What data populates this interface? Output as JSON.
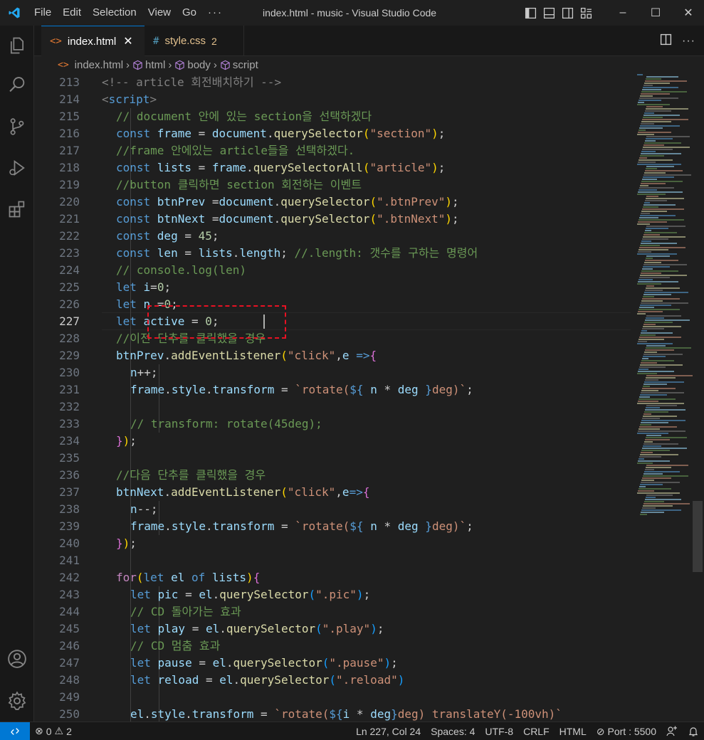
{
  "app": {
    "window_title": "index.html - music - Visual Studio Code",
    "accent": "#0078d4"
  },
  "menu": [
    "File",
    "Edit",
    "Selection",
    "View",
    "Go",
    "···"
  ],
  "window_controls": {
    "minimize": "–",
    "maximize": "☐",
    "close": "✕"
  },
  "tabs": [
    {
      "icon": "<>",
      "label": "index.html",
      "close": "✕"
    },
    {
      "icon": "#",
      "label": "style.css",
      "badge": "2"
    }
  ],
  "tab_actions": {
    "more": "···"
  },
  "breadcrumb": [
    "index.html",
    "html",
    "body",
    "script"
  ],
  "editor": {
    "current_line": 227,
    "lines": [
      {
        "n": "213",
        "tokens": [
          [
            "t",
            "<!-- article 회전배치하기 -->"
          ]
        ]
      },
      {
        "n": "214",
        "tokens": [
          [
            "t",
            "<"
          ],
          [
            "k",
            "script"
          ],
          [
            "t",
            ">"
          ]
        ]
      },
      {
        "n": "215",
        "tokens": [
          [
            "c",
            "// document 안에 있는 section을 선택하겠다"
          ]
        ]
      },
      {
        "n": "216",
        "tokens": [
          [
            "k",
            "const "
          ],
          [
            "v",
            "frame"
          ],
          [
            "d",
            " = "
          ],
          [
            "v",
            "document"
          ],
          [
            "d",
            "."
          ],
          [
            "f",
            "querySelector"
          ],
          [
            "p",
            "("
          ],
          [
            "s",
            "\"section\""
          ],
          [
            "p",
            ")"
          ],
          [
            "d",
            ";"
          ]
        ]
      },
      {
        "n": "217",
        "tokens": [
          [
            "c",
            "//frame 안에있는 article들을 선택하겠다."
          ]
        ]
      },
      {
        "n": "218",
        "tokens": [
          [
            "k",
            "const "
          ],
          [
            "v",
            "lists"
          ],
          [
            "d",
            " = "
          ],
          [
            "v",
            "frame"
          ],
          [
            "d",
            "."
          ],
          [
            "f",
            "querySelectorAll"
          ],
          [
            "p",
            "("
          ],
          [
            "s",
            "\"article\""
          ],
          [
            "p",
            ")"
          ],
          [
            "d",
            ";"
          ]
        ]
      },
      {
        "n": "219",
        "tokens": [
          [
            "c",
            "//button 클릭하면 section 회전하는 이벤트"
          ]
        ]
      },
      {
        "n": "220",
        "tokens": [
          [
            "k",
            "const "
          ],
          [
            "v",
            "btnPrev"
          ],
          [
            "d",
            " ="
          ],
          [
            "v",
            "document"
          ],
          [
            "d",
            "."
          ],
          [
            "f",
            "querySelector"
          ],
          [
            "p",
            "("
          ],
          [
            "s",
            "\".btnPrev\""
          ],
          [
            "p",
            ")"
          ],
          [
            "d",
            ";"
          ]
        ]
      },
      {
        "n": "221",
        "tokens": [
          [
            "k",
            "const "
          ],
          [
            "v",
            "btnNext"
          ],
          [
            "d",
            " ="
          ],
          [
            "v",
            "document"
          ],
          [
            "d",
            "."
          ],
          [
            "f",
            "querySelector"
          ],
          [
            "p",
            "("
          ],
          [
            "s",
            "\".btnNext\""
          ],
          [
            "p",
            ")"
          ],
          [
            "d",
            ";"
          ]
        ]
      },
      {
        "n": "222",
        "tokens": [
          [
            "k",
            "const "
          ],
          [
            "v",
            "deg"
          ],
          [
            "d",
            " = "
          ],
          [
            "n",
            "45"
          ],
          [
            "d",
            ";"
          ]
        ]
      },
      {
        "n": "223",
        "tokens": [
          [
            "k",
            "const "
          ],
          [
            "v",
            "len"
          ],
          [
            "d",
            " = "
          ],
          [
            "v",
            "lists"
          ],
          [
            "d",
            "."
          ],
          [
            "v",
            "length"
          ],
          [
            "d",
            "; "
          ],
          [
            "c",
            "//.length: 갯수를 구하는 명령어"
          ]
        ]
      },
      {
        "n": "224",
        "tokens": [
          [
            "c",
            "// console.log(len)"
          ]
        ]
      },
      {
        "n": "225",
        "tokens": [
          [
            "k",
            "let "
          ],
          [
            "v",
            "i"
          ],
          [
            "d",
            "="
          ],
          [
            "n",
            "0"
          ],
          [
            "d",
            ";"
          ]
        ]
      },
      {
        "n": "226",
        "tokens": [
          [
            "k",
            "let "
          ],
          [
            "v",
            "n"
          ],
          [
            "d",
            " ="
          ],
          [
            "n",
            "0"
          ],
          [
            "d",
            ";"
          ]
        ]
      },
      {
        "n": "227",
        "tokens": [
          [
            "k",
            "let "
          ],
          [
            "v",
            "active"
          ],
          [
            "d",
            " = "
          ],
          [
            "n",
            "0"
          ],
          [
            "d",
            ";"
          ]
        ]
      },
      {
        "n": "228",
        "tokens": [
          [
            "c",
            "//이전 단추를 클릭했을 경우"
          ]
        ]
      },
      {
        "n": "229",
        "tokens": [
          [
            "v",
            "btnPrev"
          ],
          [
            "d",
            "."
          ],
          [
            "f",
            "addEventListener"
          ],
          [
            "p",
            "("
          ],
          [
            "s",
            "\"click\""
          ],
          [
            "d",
            ","
          ],
          [
            "v",
            "e"
          ],
          [
            "k",
            " =>"
          ],
          [
            "pp",
            "{"
          ]
        ]
      },
      {
        "n": "230",
        "tokens": [
          [
            "v",
            "n"
          ],
          [
            "d",
            "++;"
          ]
        ]
      },
      {
        "n": "231",
        "tokens": [
          [
            "v",
            "frame"
          ],
          [
            "d",
            "."
          ],
          [
            "v",
            "style"
          ],
          [
            "d",
            "."
          ],
          [
            "v",
            "transform"
          ],
          [
            "d",
            " = "
          ],
          [
            "s",
            "`rotate("
          ],
          [
            "k",
            "${"
          ],
          [
            "d",
            " "
          ],
          [
            "v",
            "n"
          ],
          [
            "d",
            " * "
          ],
          [
            "v",
            "deg"
          ],
          [
            "d",
            " "
          ],
          [
            "k",
            "}"
          ],
          [
            "s",
            "deg)`"
          ],
          [
            "d",
            ";"
          ]
        ]
      },
      {
        "n": "232",
        "tokens": []
      },
      {
        "n": "233",
        "tokens": [
          [
            "c",
            "// transform: rotate(45deg);"
          ]
        ]
      },
      {
        "n": "234",
        "tokens": [
          [
            "pp",
            "}"
          ],
          [
            "p",
            ")"
          ],
          [
            "d",
            ";"
          ]
        ]
      },
      {
        "n": "235",
        "tokens": []
      },
      {
        "n": "236",
        "tokens": [
          [
            "c",
            "//다음 단추를 클릭했을 경우"
          ]
        ]
      },
      {
        "n": "237",
        "tokens": [
          [
            "v",
            "btnNext"
          ],
          [
            "d",
            "."
          ],
          [
            "f",
            "addEventListener"
          ],
          [
            "p",
            "("
          ],
          [
            "s",
            "\"click\""
          ],
          [
            "d",
            ","
          ],
          [
            "v",
            "e"
          ],
          [
            "k",
            "=>"
          ],
          [
            "pp",
            "{"
          ]
        ]
      },
      {
        "n": "238",
        "tokens": [
          [
            "v",
            "n"
          ],
          [
            "d",
            "--;"
          ]
        ]
      },
      {
        "n": "239",
        "tokens": [
          [
            "v",
            "frame"
          ],
          [
            "d",
            "."
          ],
          [
            "v",
            "style"
          ],
          [
            "d",
            "."
          ],
          [
            "v",
            "transform"
          ],
          [
            "d",
            " = "
          ],
          [
            "s",
            "`rotate("
          ],
          [
            "k",
            "${"
          ],
          [
            "d",
            " "
          ],
          [
            "v",
            "n"
          ],
          [
            "d",
            " * "
          ],
          [
            "v",
            "deg"
          ],
          [
            "d",
            " "
          ],
          [
            "k",
            "}"
          ],
          [
            "s",
            "deg)`"
          ],
          [
            "d",
            ";"
          ]
        ]
      },
      {
        "n": "240",
        "tokens": [
          [
            "pp",
            "}"
          ],
          [
            "p",
            ")"
          ],
          [
            "d",
            ";"
          ]
        ]
      },
      {
        "n": "241",
        "tokens": []
      },
      {
        "n": "242",
        "tokens": [
          [
            "cc",
            "for"
          ],
          [
            "p",
            "("
          ],
          [
            "k",
            "let "
          ],
          [
            "v",
            "el"
          ],
          [
            "k",
            " of "
          ],
          [
            "v",
            "lists"
          ],
          [
            "p",
            ")"
          ],
          [
            "pp",
            "{"
          ]
        ]
      },
      {
        "n": "243",
        "tokens": [
          [
            "k",
            "let "
          ],
          [
            "v",
            "pic"
          ],
          [
            "d",
            " = "
          ],
          [
            "v",
            "el"
          ],
          [
            "d",
            "."
          ],
          [
            "f",
            "querySelector"
          ],
          [
            "pb",
            "("
          ],
          [
            "s",
            "\".pic\""
          ],
          [
            "pb",
            ")"
          ],
          [
            "d",
            ";"
          ]
        ]
      },
      {
        "n": "244",
        "tokens": [
          [
            "c",
            "// CD 돌아가는 효과"
          ]
        ]
      },
      {
        "n": "245",
        "tokens": [
          [
            "k",
            "let "
          ],
          [
            "v",
            "play"
          ],
          [
            "d",
            " = "
          ],
          [
            "v",
            "el"
          ],
          [
            "d",
            "."
          ],
          [
            "f",
            "querySelector"
          ],
          [
            "pb",
            "("
          ],
          [
            "s",
            "\".play\""
          ],
          [
            "pb",
            ")"
          ],
          [
            "d",
            ";"
          ]
        ]
      },
      {
        "n": "246",
        "tokens": [
          [
            "c",
            "// CD 멈춤 효과"
          ]
        ]
      },
      {
        "n": "247",
        "tokens": [
          [
            "k",
            "let "
          ],
          [
            "v",
            "pause"
          ],
          [
            "d",
            " = "
          ],
          [
            "v",
            "el"
          ],
          [
            "d",
            "."
          ],
          [
            "f",
            "querySelector"
          ],
          [
            "pb",
            "("
          ],
          [
            "s",
            "\".pause\""
          ],
          [
            "pb",
            ")"
          ],
          [
            "d",
            ";"
          ]
        ]
      },
      {
        "n": "248",
        "tokens": [
          [
            "k",
            "let "
          ],
          [
            "v",
            "reload"
          ],
          [
            "d",
            " = "
          ],
          [
            "v",
            "el"
          ],
          [
            "d",
            "."
          ],
          [
            "f",
            "querySelector"
          ],
          [
            "pb",
            "("
          ],
          [
            "s",
            "\".reload\""
          ],
          [
            "pb",
            ")"
          ]
        ]
      },
      {
        "n": "249",
        "tokens": []
      },
      {
        "n": "250",
        "tokens": [
          [
            "v",
            "el"
          ],
          [
            "d",
            "."
          ],
          [
            "v",
            "style"
          ],
          [
            "d",
            "."
          ],
          [
            "v",
            "transform"
          ],
          [
            "d",
            " = "
          ],
          [
            "s",
            "`rotate("
          ],
          [
            "k",
            "${"
          ],
          [
            "v",
            "i"
          ],
          [
            "d",
            " * "
          ],
          [
            "v",
            "deg"
          ],
          [
            "k",
            "}"
          ],
          [
            "s",
            "deg) translateY(-100vh)`"
          ]
        ]
      }
    ]
  },
  "statusbar": {
    "errors": "0",
    "warnings": "2",
    "position": "Ln 227, Col 24",
    "spaces": "Spaces: 4",
    "encoding": "UTF-8",
    "eol": "CRLF",
    "language": "HTML",
    "port": "Port : 5500"
  }
}
